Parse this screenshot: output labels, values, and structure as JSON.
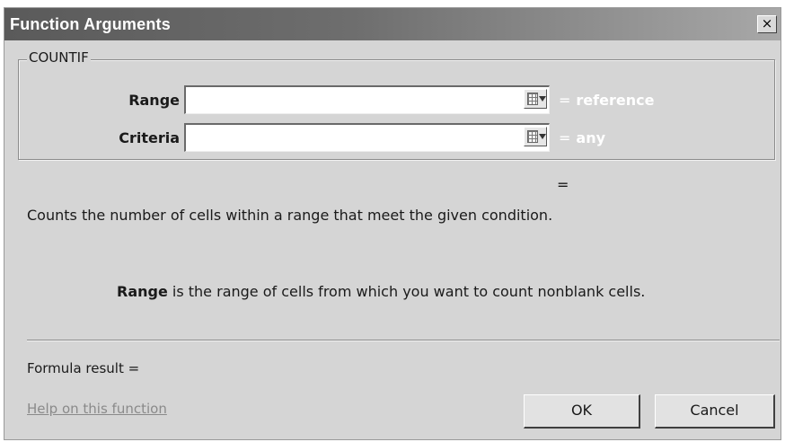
{
  "window": {
    "title": "Function Arguments",
    "close_label": "×"
  },
  "function_group": {
    "name": "COUNTIF",
    "arguments": [
      {
        "label": "Range",
        "value": "",
        "result_eq": "=",
        "result": "reference"
      },
      {
        "label": "Criteria",
        "value": "",
        "result_eq": "=",
        "result": "any"
      }
    ]
  },
  "overall_equals": "=",
  "description": "Counts the number of cells within a range that meet the given condition.",
  "argument_help": {
    "name": "Range",
    "text": " is the range of cells from which you want to count nonblank cells."
  },
  "formula_result": "Formula result =",
  "help_link": "Help on this function",
  "buttons": {
    "ok": "OK",
    "cancel": "Cancel"
  }
}
